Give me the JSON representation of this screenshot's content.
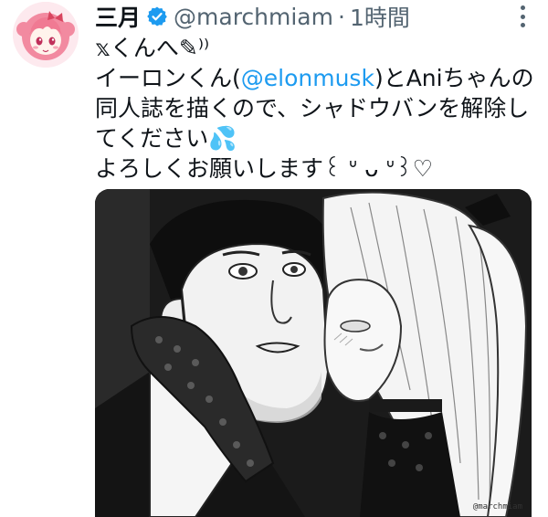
{
  "author": {
    "display_name": "三月",
    "handle": "@marchmiam",
    "separator": "·",
    "time": "1時間",
    "verified": true,
    "avatar_icon": "avatar-anime-girl"
  },
  "menu_icon": "more-vertical-icon",
  "tweet": {
    "line1": "𝕩くんへ✎⁾⁾",
    "line2_pre": "イーロンくん(",
    "line2_mention": "@elonmusk",
    "line2_post": ")とAniちゃんの",
    "line3": "同人誌を描くので、シャドウバンを解除し",
    "line4_text": "てください",
    "line4_emoji": "💦",
    "line5": "よろしくお願いします꒰ ᐡ ᴗ ᐡ꒱♡"
  },
  "media": {
    "alt": "manga illustration",
    "watermark": "@marchmiam"
  },
  "colors": {
    "link": "#1d9bf0",
    "verified": "#1d9bf0",
    "secondary_text": "#536471",
    "primary_text": "#0f1419"
  }
}
